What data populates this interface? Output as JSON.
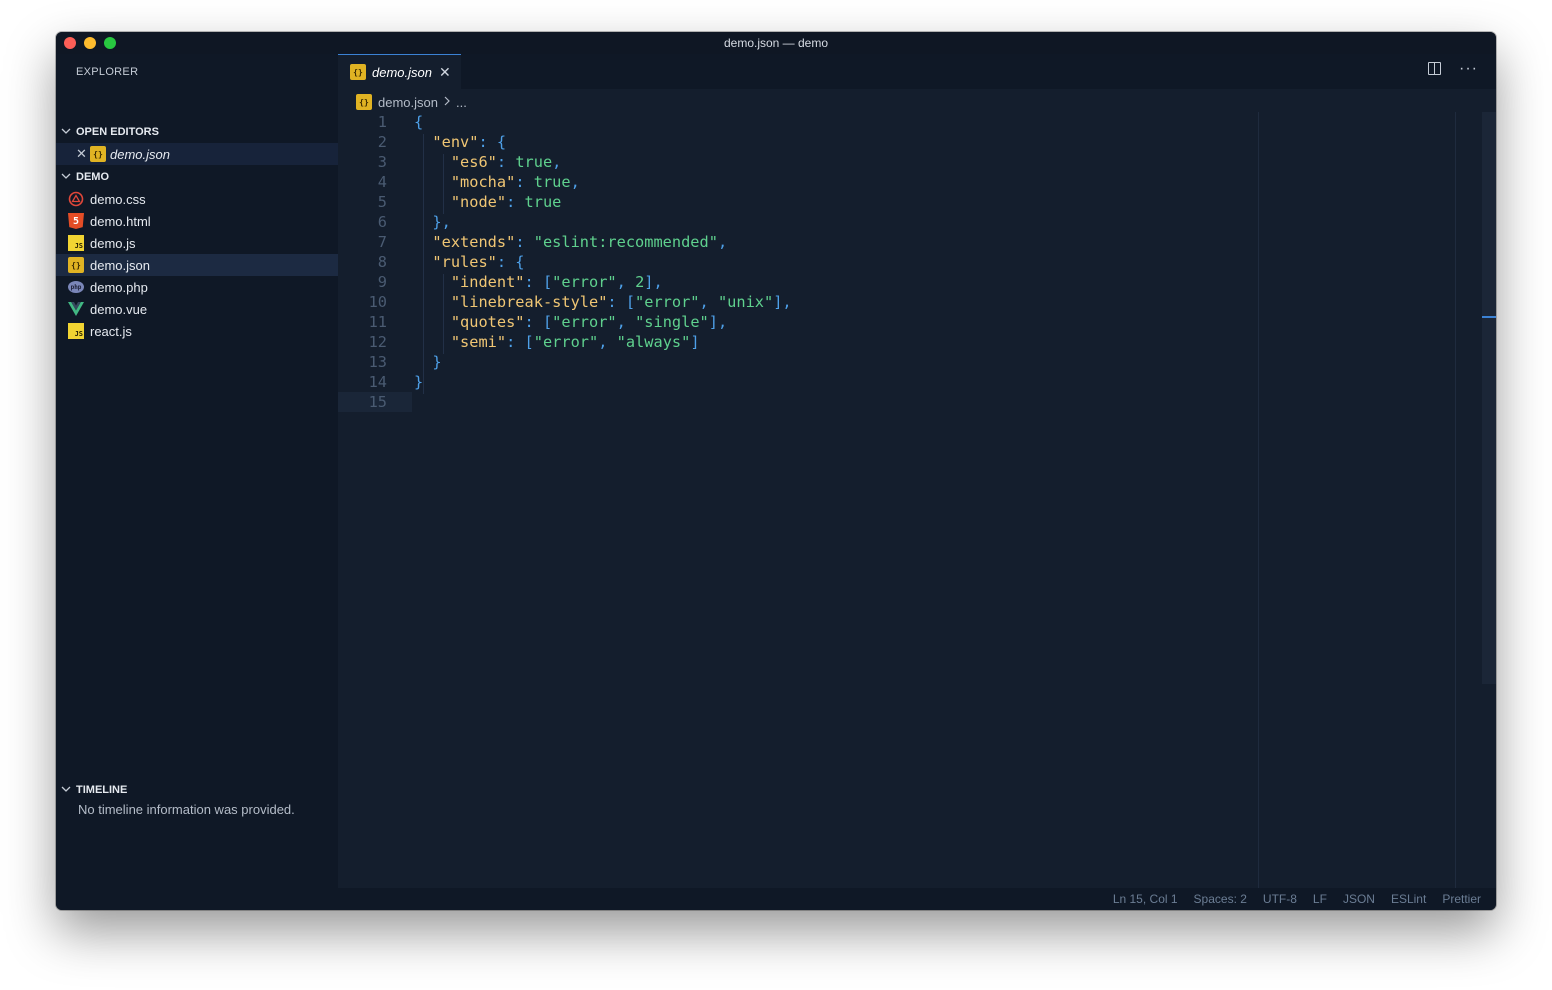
{
  "window": {
    "title": "demo.json — demo"
  },
  "sidebar": {
    "title": "EXPLORER",
    "open_editors": {
      "label": "OPEN EDITORS",
      "items": [
        {
          "name": "demo.json",
          "icon": "json-file-icon"
        }
      ]
    },
    "project": {
      "label": "DEMO",
      "files": [
        {
          "name": "demo.css",
          "icon": "css-file-icon"
        },
        {
          "name": "demo.html",
          "icon": "html-file-icon"
        },
        {
          "name": "demo.js",
          "icon": "js-file-icon"
        },
        {
          "name": "demo.json",
          "icon": "json-file-icon",
          "selected": true
        },
        {
          "name": "demo.php",
          "icon": "php-file-icon"
        },
        {
          "name": "demo.vue",
          "icon": "vue-file-icon"
        },
        {
          "name": "react.js",
          "icon": "js-file-icon"
        }
      ]
    },
    "timeline": {
      "label": "TIMELINE",
      "message": "No timeline information was provided."
    }
  },
  "editor": {
    "tab": {
      "label": "demo.json"
    },
    "breadcrumb": {
      "file": "demo.json",
      "rest": "..."
    },
    "lines": [
      {
        "n": "1"
      },
      {
        "n": "2"
      },
      {
        "n": "3"
      },
      {
        "n": "4"
      },
      {
        "n": "5"
      },
      {
        "n": "6"
      },
      {
        "n": "7"
      },
      {
        "n": "8"
      },
      {
        "n": "9"
      },
      {
        "n": "10"
      },
      {
        "n": "11"
      },
      {
        "n": "12"
      },
      {
        "n": "13"
      },
      {
        "n": "14"
      },
      {
        "n": "15"
      }
    ],
    "code": {
      "env_key": "\"env\"",
      "es6_key": "\"es6\"",
      "mocha_key": "\"mocha\"",
      "node_key": "\"node\"",
      "extends_key": "\"extends\"",
      "extends_val": "\"eslint:recommended\"",
      "rules_key": "\"rules\"",
      "indent_key": "\"indent\"",
      "linebreak_key": "\"linebreak-style\"",
      "quotes_key": "\"quotes\"",
      "semi_key": "\"semi\"",
      "true_val": "true",
      "error_val": "\"error\"",
      "two_val": "2",
      "unix_val": "\"unix\"",
      "single_val": "\"single\"",
      "always_val": "\"always\""
    }
  },
  "statusbar": {
    "position": "Ln 15, Col 1",
    "spaces": "Spaces: 2",
    "encoding": "UTF-8",
    "eol": "LF",
    "language": "JSON",
    "eslint": "ESLint",
    "prettier": "Prettier"
  },
  "colors": {
    "background": "#141e2d",
    "sidebar": "#0f1826",
    "punctuation": "#4ea0e8",
    "key": "#f0c674",
    "string": "#5fd18e",
    "accent": "#3b82d4"
  }
}
